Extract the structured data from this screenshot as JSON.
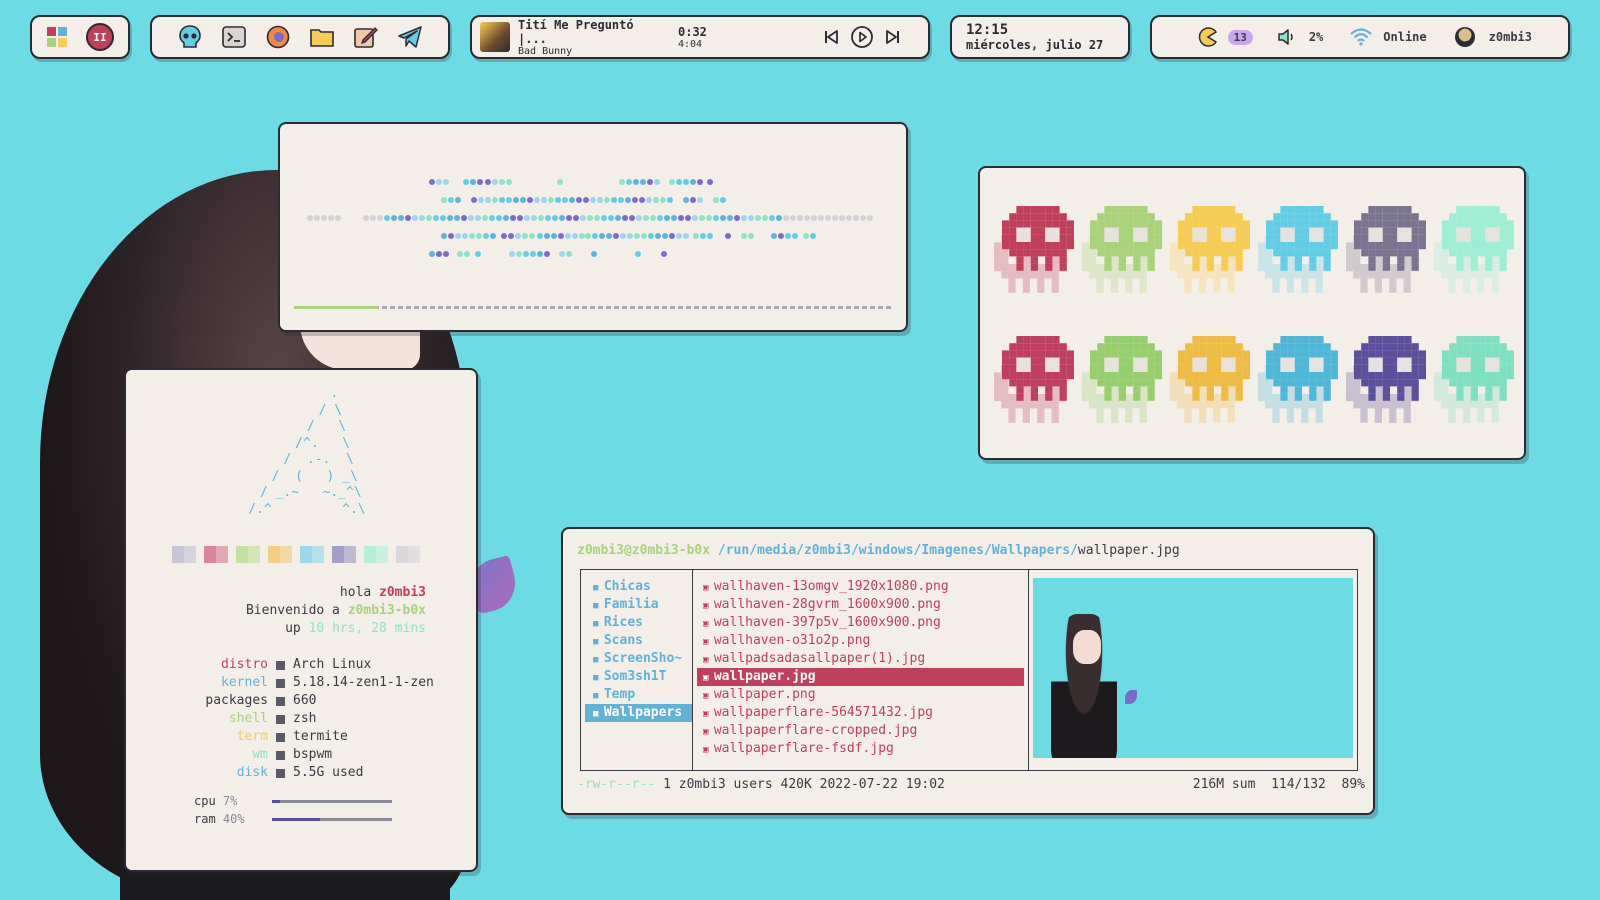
{
  "colors": {
    "background": "#6ddbe3",
    "card": "#f3eee8",
    "border": "#2b2b33",
    "red": "#c0405c",
    "green": "#a8d37a",
    "yellow": "#f7cc55",
    "blue": "#5fb3d8",
    "purple": "#7a6ea8",
    "teal": "#8ee3c8"
  },
  "topbar": {
    "launcher": {
      "icons": [
        "windows-grid-icon",
        "pause-circle-icon"
      ],
      "pause_glyph": "II"
    },
    "apps": {
      "icons": [
        "skull-icon",
        "terminal-icon",
        "firefox-icon",
        "folder-icon",
        "editor-icon",
        "telegram-icon"
      ]
    },
    "music": {
      "title": "Tití Me Preguntó |...",
      "artist": "Bad Bunny",
      "elapsed": "0:32",
      "duration": "4:04",
      "controls": [
        "previous-icon",
        "play-icon",
        "next-icon"
      ]
    },
    "clock": {
      "time": "12:15",
      "date": "miércoles, julio 27"
    },
    "status": {
      "updates_count": "13",
      "volume": "2%",
      "network": "Online",
      "user": "z0mbi3"
    }
  },
  "visualizer": {
    "progress": 0.14
  },
  "skulls": {
    "rows": [
      [
        "#c0405c",
        "#a8d37a",
        "#f7cc55",
        "#64cde6",
        "#7a7491",
        "#9deed5"
      ],
      [
        "#bf3f5f",
        "#98cf6e",
        "#eebb44",
        "#4fb7d8",
        "#5c4f9c",
        "#7ee0c0"
      ]
    ]
  },
  "fetch": {
    "logo": "        .\n       / \\\n      /   \\\n     /^.   \\\n    /  .-.  \\\n   /  (   ) _\\\n  / _.~   ~._^\\\n /.^         ^.\\",
    "palette": [
      "#c8c6d6",
      "#d9849a",
      "#c5e0a0",
      "#f4cd82",
      "#9bd9ea",
      "#a59ec6",
      "#b5efd9",
      "#d9d6dc"
    ],
    "hello_word": "hola",
    "user": "z0mbi3",
    "welcome_word": "Bienvenido a",
    "host": "z0mbi3-b0x",
    "up_word": "up",
    "uptime": "10 hrs, 28 mins",
    "info": [
      {
        "key": "distro",
        "value": "Arch Linux",
        "color": "#c0405c"
      },
      {
        "key": "kernel",
        "value": "5.18.14-zen1-1-zen",
        "color": "#5fb3d8"
      },
      {
        "key": "packages",
        "value": "660",
        "color": "#3a3a44"
      },
      {
        "key": "shell",
        "value": "zsh",
        "color": "#a8d37a"
      },
      {
        "key": "term",
        "value": "termite",
        "color": "#f7cc55"
      },
      {
        "key": "wm",
        "value": "bspwm",
        "color": "#8ee3c8"
      },
      {
        "key": "disk",
        "value": "5.5G used",
        "color": "#5fb3d8"
      }
    ],
    "cpu": {
      "label": "cpu",
      "value": "7%",
      "fraction": 0.07
    },
    "ram": {
      "label": "ram",
      "value": "40%",
      "fraction": 0.4
    }
  },
  "ranger": {
    "prompt": "z0mbi3@z0mbi3-b0x",
    "path": "/run/media/z0mbi3/windows/Imagenes/Wallpapers/",
    "file": "wallpaper.jpg",
    "dirs": [
      "Chicas",
      "Familia",
      "Rices",
      "Scans",
      "ScreenSho~",
      "Som3sh1T",
      "Temp",
      "Wallpapers"
    ],
    "selected_dir": 7,
    "files": [
      "wallhaven-13omgv_1920x1080.png",
      "wallhaven-28gvrm_1600x900.png",
      "wallhaven-397p5v_1600x900.png",
      "wallhaven-o31o2p.png",
      "wallpadsadasallpaper(1).jpg",
      "wallpaper.jpg",
      "wallpaper.png",
      "wallpaperflare-564571432.jpg",
      "wallpaperflare-cropped.jpg",
      "wallpaperflare-fsdf.jpg"
    ],
    "selected_file": 5,
    "status_perms": "-rw-r--r--",
    "status_info": "1 z0mbi3 users 420K 2022-07-22 19:02",
    "status_sum": "216M sum",
    "status_pos": "114/132",
    "status_pct": "89%"
  }
}
